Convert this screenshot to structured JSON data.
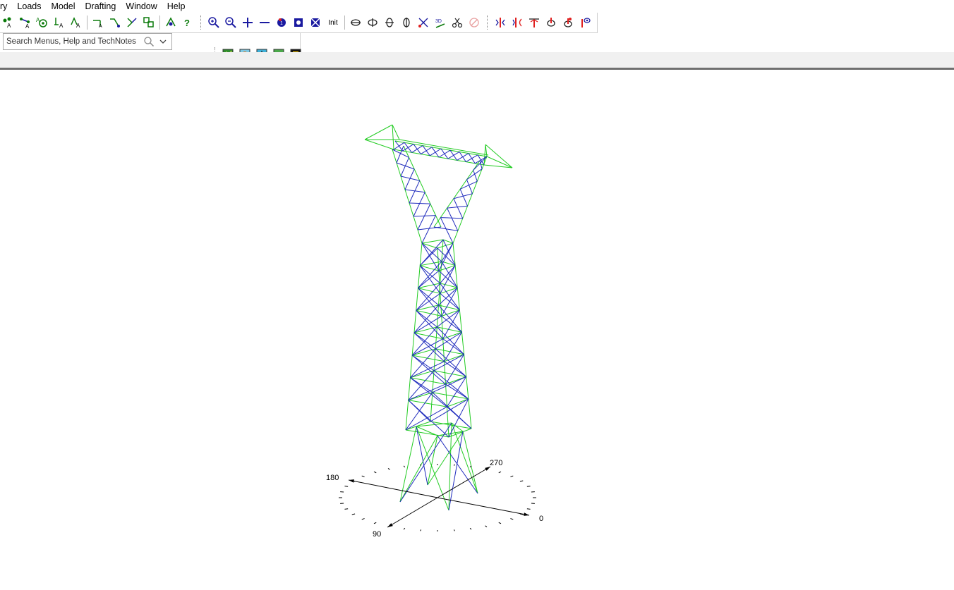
{
  "menu": [
    "ry",
    "Loads",
    "Model",
    "Drafting",
    "Window",
    "Help"
  ],
  "toolbar": {
    "group_a": [
      "add-node-icon",
      "add-member-icon",
      "add-support-icon",
      "add-load-icon",
      "add-label-icon"
    ],
    "group_b": [
      "member-end-icon",
      "member-release-icon",
      "connect-icon",
      "merge-icon"
    ],
    "group_c": [
      "assign-icon",
      "query-icon"
    ],
    "view_group": [
      "zoom-in-icon",
      "zoom-out-icon",
      "plus-icon",
      "minus-icon",
      "view-info-icon",
      "zoom-extent-icon",
      "zoom-window-icon"
    ],
    "init_label": "Init",
    "rotate_group": [
      "rotate-x-icon",
      "rotate-y-icon",
      "rotate-z-icon",
      "rotate-minus-z-icon",
      "view-3d-icon",
      "view-3d-text-icon",
      "cut-icon",
      "undo-view-icon"
    ],
    "display_group": [
      "display-forces-icon",
      "display-moments-icon",
      "display-loads-icon",
      "display-deflection-icon",
      "display-stress-icon",
      "display-options-icon"
    ],
    "view_3d_label": "3D",
    "second_row": [
      "plot-view-icon",
      "render-icon",
      "section-icon",
      "image-icon",
      "frame-icon"
    ]
  },
  "search": {
    "placeholder": "Search Menus, Help and TechNotes"
  },
  "compass": {
    "labels": [
      "180",
      "270",
      "0",
      "90"
    ]
  },
  "colors": {
    "tower_outline": "#22cc22",
    "tower_bracing": "#1f2bbd",
    "compass": "#000000"
  }
}
